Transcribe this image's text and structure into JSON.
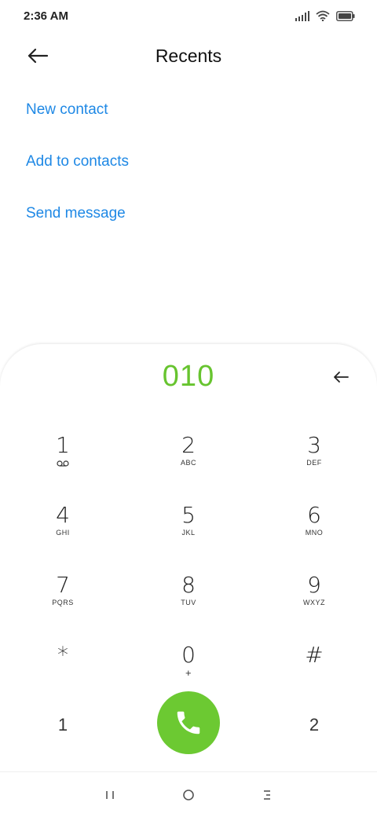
{
  "status_bar": {
    "time": "2:36 AM",
    "icons": [
      "signal-icon",
      "wifi-icon",
      "battery-icon"
    ]
  },
  "header": {
    "title": "Recents",
    "back_icon": "arrow-left-icon"
  },
  "actions": [
    {
      "label": "New contact"
    },
    {
      "label": "Add to contacts"
    },
    {
      "label": "Send message"
    }
  ],
  "dialer": {
    "number": "010",
    "backspace_icon": "backspace-icon",
    "keys": [
      {
        "digit": "1",
        "letters": ""
      },
      {
        "digit": "2",
        "letters": "ABC"
      },
      {
        "digit": "3",
        "letters": "DEF"
      },
      {
        "digit": "4",
        "letters": "GHI"
      },
      {
        "digit": "5",
        "letters": "JKL"
      },
      {
        "digit": "6",
        "letters": "MNO"
      },
      {
        "digit": "7",
        "letters": "PQRS"
      },
      {
        "digit": "8",
        "letters": "TUV"
      },
      {
        "digit": "9",
        "letters": "WXYZ"
      },
      {
        "digit": "*",
        "letters": ""
      },
      {
        "digit": "0",
        "letters": "+"
      },
      {
        "digit": "#",
        "letters": ""
      }
    ],
    "sim1_label": "1",
    "sim2_label": "2",
    "call_icon": "phone-icon"
  },
  "colors": {
    "accent_blue": "#1e88e5",
    "dial_green": "#67c42f",
    "call_green": "#6cc932"
  },
  "nav_bar": {
    "icons": [
      "recent-apps-icon",
      "home-icon",
      "back-menu-icon"
    ]
  }
}
